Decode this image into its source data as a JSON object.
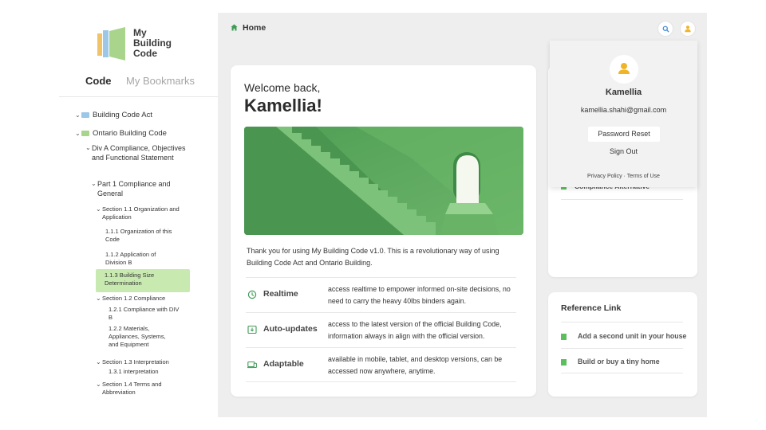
{
  "app": {
    "logo_lines": [
      "My",
      "Building",
      "Code"
    ]
  },
  "sidebar": {
    "tabs": [
      {
        "label": "Code",
        "active": true
      },
      {
        "label": "My Bookmarks",
        "active": false
      }
    ],
    "tree": [
      {
        "label": "Building Code Act",
        "level": 0,
        "expanded": true,
        "icon": "folder-blue-icon"
      },
      {
        "label": "Ontario Building Code",
        "level": 0,
        "expanded": true,
        "icon": "folder-green-icon"
      },
      {
        "label": "Div A Compliance, Objectives and Functional Statement",
        "level": 1,
        "expanded": true
      },
      {
        "label": "Part 1 Compliance and General",
        "level": 2,
        "expanded": true
      },
      {
        "label": "Section 1.1 Organization and Application",
        "level": 3,
        "expanded": true
      },
      {
        "label": "1.1.1 Organization of this Code",
        "level": 4
      },
      {
        "label": "1.1.2 Application of Division B",
        "level": 4
      },
      {
        "label": "1.1.3 Building Size Determination",
        "level": 4,
        "selected": true
      },
      {
        "label": "Section 1.2 Compliance",
        "level": 3,
        "expanded": true
      },
      {
        "label": "1.2.1 Compliance with DIV B",
        "level": 4
      },
      {
        "label": "1.2.2 Materials, Appliances, Systems, and Equipment",
        "level": 4
      },
      {
        "label": "Section 1.3 Interpretation",
        "level": 3,
        "expanded": true
      },
      {
        "label": "1.3.1 interpretation",
        "level": 4
      },
      {
        "label": "Section 1.4 Terms and Abbreviation",
        "level": 3,
        "expanded": true
      }
    ]
  },
  "header": {
    "breadcrumb": "Home",
    "icons": [
      "search-icon",
      "user-icon"
    ]
  },
  "welcome": {
    "greeting": "Welcome back,",
    "name": "Kamellia!",
    "intro": "Thank you for using My Building Code v1.0. This is a revolutionary way of using Building Code Act and Ontario Building.",
    "features": [
      {
        "title": "Realtime",
        "icon": "clock-icon",
        "desc": "access realtime to empower informed on-site decisions, no need to carry the heavy 40lbs binders again."
      },
      {
        "title": "Auto-updates",
        "icon": "update-icon",
        "desc": "access to the latest version of the official Building Code, information always in align with the official version."
      },
      {
        "title": "Adaptable",
        "icon": "devices-icon",
        "desc": "available in mobile, tablet, and desktop versions, can be accessed now anywhere, anytime."
      }
    ]
  },
  "partial_card": {
    "item": "Compliance Alternative"
  },
  "reference": {
    "title": "Reference Link",
    "links": [
      "Add a second unit in your house",
      "Build or buy a tiny home"
    ]
  },
  "profile": {
    "name": "Kamellia",
    "email": "kamellia.shahi@gmail.com",
    "password_reset": "Password Reset",
    "sign_out": "Sign Out",
    "footer": "Privacy Policy · Terms of Use"
  },
  "colors": {
    "accent_green": "#3e9a54",
    "selected_bg": "#c8eab0",
    "avatar_yellow": "#f0b429",
    "search_blue": "#4a90d9"
  }
}
